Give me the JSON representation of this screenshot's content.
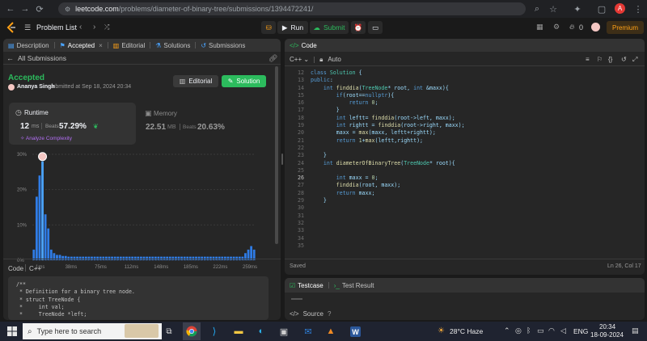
{
  "browser": {
    "url_host": "leetcode.com",
    "url_path": "/problems/diameter-of-binary-tree/submissions/1394472241/",
    "avatar_letter": "A"
  },
  "topbar": {
    "problem_list": "Problem List",
    "run": "Run",
    "submit": "Submit",
    "fire_count": "0",
    "premium": "Premium"
  },
  "left": {
    "tabs": [
      {
        "label": "Description"
      },
      {
        "label": "Accepted"
      },
      {
        "label": "Editorial"
      },
      {
        "label": "Solutions"
      },
      {
        "label": "Submissions"
      }
    ],
    "all_submissions": "All Submissions",
    "status": "Accepted",
    "user": "Ananya Singh",
    "submitted_at": "submitted at Sep 18, 2024 20:34",
    "editorial_btn": "Editorial",
    "solution_btn": "Solution",
    "runtime": {
      "label": "Runtime",
      "value": "12",
      "unit": "ms",
      "beats_label": "Beats",
      "beats": "57.29%",
      "analyze": "Analyze Complexity"
    },
    "memory": {
      "label": "Memory",
      "value": "22.51",
      "unit": "MB",
      "beats_label": "Beats",
      "beats": "20.63%"
    },
    "code_label": "Code",
    "code_lang": "C++",
    "code_preview": [
      "/**",
      " * Definition for a binary tree node.",
      " * struct TreeNode {",
      " *     int val;",
      " *     TreeNode *left;"
    ]
  },
  "chart_data": {
    "type": "bar",
    "yticks": [
      "30%",
      "20%",
      "10%",
      "0%"
    ],
    "xticks": [
      "1ms",
      "38ms",
      "75ms",
      "112ms",
      "148ms",
      "185ms",
      "222ms",
      "259ms"
    ],
    "mini_ticks": [
      "1ms",
      "75ms",
      "148ms",
      "222ms"
    ],
    "ylim": [
      0,
      30
    ],
    "values": [
      3,
      18,
      24,
      28,
      13,
      9,
      3,
      2,
      1.5,
      1.5,
      1.2,
      1.2,
      1,
      1,
      1,
      1,
      1,
      1,
      1,
      1,
      1,
      1,
      1,
      1,
      1,
      1,
      1,
      1,
      1,
      1,
      1,
      1,
      1,
      1,
      1,
      1,
      1,
      1,
      1,
      1,
      1,
      1,
      1,
      1,
      1,
      1,
      1,
      1,
      1,
      1,
      1,
      1,
      1,
      1,
      1,
      1,
      1,
      1,
      1,
      1,
      1,
      1,
      1,
      1,
      1,
      1,
      1,
      1,
      1,
      1,
      1,
      1,
      1,
      2,
      3,
      4,
      3
    ],
    "highlight_index": 3
  },
  "editor": {
    "title": "Code",
    "lang": "C++",
    "mode": "Auto",
    "status_saved": "Saved",
    "cursor": "Ln 26, Col 17",
    "lines": [
      {
        "n": "12",
        "t": "class Solution {"
      },
      {
        "n": "13",
        "t": "public:"
      },
      {
        "n": "14",
        "t": "    int finddia(TreeNode* root, int &maxx){"
      },
      {
        "n": "15",
        "t": "        if(root==nullptr){"
      },
      {
        "n": "16",
        "t": "            return 0;"
      },
      {
        "n": "17",
        "t": "        }"
      },
      {
        "n": "18",
        "t": "        int leftt= finddia(root->left, maxx);"
      },
      {
        "n": "19",
        "t": "        int rightt = finddia(root->right, maxx);"
      },
      {
        "n": "20",
        "t": "        maxx = max(maxx, leftt+rightt);"
      },
      {
        "n": "21",
        "t": "        return 1+max(leftt,rightt);"
      },
      {
        "n": "22",
        "t": ""
      },
      {
        "n": "23",
        "t": "    }"
      },
      {
        "n": "24",
        "t": "    int diameterOfBinaryTree(TreeNode* root){"
      },
      {
        "n": "25",
        "t": ""
      },
      {
        "n": "26",
        "t": "        int maxx = 0;"
      },
      {
        "n": "27",
        "t": "        finddia(root, maxx);"
      },
      {
        "n": "28",
        "t": "        return maxx;"
      },
      {
        "n": "29",
        "t": "    }"
      },
      {
        "n": "30",
        "t": ""
      },
      {
        "n": "31",
        "t": ""
      },
      {
        "n": "32",
        "t": ""
      },
      {
        "n": "33",
        "t": ""
      },
      {
        "n": "34",
        "t": ""
      },
      {
        "n": "35",
        "t": ""
      }
    ]
  },
  "testcase": {
    "tab1": "Testcase",
    "tab2": "Test Result",
    "source": "Source"
  },
  "taskbar": {
    "search_placeholder": "Type here to search",
    "weather": "28°C  Haze",
    "lang": "ENG",
    "time": "20:34",
    "date": "18-09-2024"
  }
}
